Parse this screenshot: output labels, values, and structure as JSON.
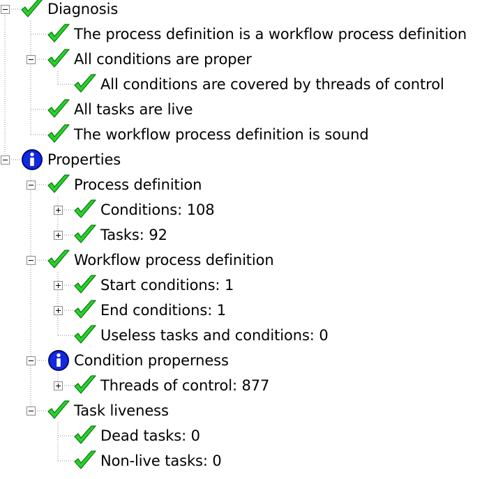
{
  "tree": {
    "nodes": [
      {
        "id": "diagnosis",
        "label": "Diagnosis",
        "icon": "check-icon",
        "expanded": true
      },
      {
        "id": "workflow-definition-check",
        "label": "The process definition is a workflow process definition",
        "icon": "check-icon"
      },
      {
        "id": "conditions-proper",
        "label": "All conditions are proper",
        "icon": "check-icon",
        "expanded": true
      },
      {
        "id": "conditions-covered",
        "label": "All conditions are covered by threads of control",
        "icon": "check-icon"
      },
      {
        "id": "tasks-live",
        "label": "All tasks are live",
        "icon": "check-icon"
      },
      {
        "id": "definition-sound",
        "label": "The workflow process definition is sound",
        "icon": "check-icon"
      },
      {
        "id": "properties",
        "label": "Properties",
        "icon": "info-icon",
        "expanded": true
      },
      {
        "id": "process-definition",
        "label": "Process definition",
        "icon": "check-icon",
        "expanded": true
      },
      {
        "id": "conditions-count",
        "label": "Conditions: 108",
        "icon": "check-icon",
        "expanded": false
      },
      {
        "id": "tasks-count",
        "label": "Tasks: 92",
        "icon": "check-icon",
        "expanded": false
      },
      {
        "id": "workflow-process-definition",
        "label": "Workflow process definition",
        "icon": "check-icon",
        "expanded": true
      },
      {
        "id": "start-conditions",
        "label": "Start conditions: 1",
        "icon": "check-icon",
        "expanded": false
      },
      {
        "id": "end-conditions",
        "label": "End conditions: 1",
        "icon": "check-icon",
        "expanded": false
      },
      {
        "id": "useless-items",
        "label": "Useless tasks and conditions: 0",
        "icon": "check-icon"
      },
      {
        "id": "condition-properness",
        "label": "Condition properness",
        "icon": "info-icon",
        "expanded": true
      },
      {
        "id": "threads-of-control",
        "label": "Threads of control: 877",
        "icon": "check-icon",
        "expanded": false
      },
      {
        "id": "task-liveness",
        "label": "Task liveness",
        "icon": "check-icon",
        "expanded": true
      },
      {
        "id": "dead-tasks",
        "label": "Dead tasks: 0",
        "icon": "check-icon"
      },
      {
        "id": "non-live-tasks",
        "label": "Non-live tasks: 0",
        "icon": "check-icon"
      }
    ]
  },
  "colors": {
    "check_fill": "#28d22b",
    "check_stroke": "#0e7a11",
    "info_fill": "#1428e0",
    "info_stroke": "#000a70",
    "guide_line": "#8c8c8c",
    "toggle_border": "#8a8a8a"
  }
}
